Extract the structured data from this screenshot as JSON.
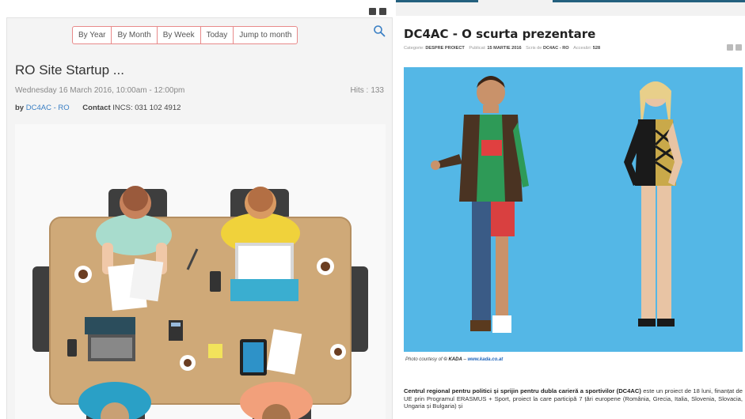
{
  "calendar": {
    "nav": [
      "By Year",
      "By Month",
      "By Week",
      "Today",
      "Jump to month"
    ],
    "event": {
      "title": "RO Site Startup ...",
      "datetime": "Wednesday 16 March 2016, 10:00am - 12:00pm",
      "hits_label": "Hits :",
      "hits_value": "133",
      "by_label": "by",
      "author": "DC4AC - RO",
      "contact_label": "Contact",
      "contact_value": "INCS: 031 102 4912"
    }
  },
  "article": {
    "title": "DC4AC - O scurta prezentare",
    "meta": {
      "category_label": "Categorie:",
      "category": "DESPRE PROIECT",
      "published_label": "Publicat:",
      "published": "15 MARTIE 2016",
      "author_label": "Scris de",
      "author": "DC4AC - RO",
      "views_label": "Accesări:",
      "views": "528"
    },
    "caption": {
      "prefix": "Photo courtesy of",
      "owner": "© KADA",
      "dash": "–",
      "link": "www.kada.co.at"
    },
    "body_lead": "Centrul regional pentru politici și sprijin pentru dubla carieră a sportivilor (DC4AC)",
    "body_rest": "este un proiect de 18 luni, finanțat de UE prin Programul ERASMUS + Sport, proiect la care participă 7 țări europene (România, Grecia, Italia, Slovenia, Slovacia, Ungaria și Bulgaria) și"
  },
  "icons": [
    "print-icon",
    "email-icon",
    "search-icon"
  ]
}
